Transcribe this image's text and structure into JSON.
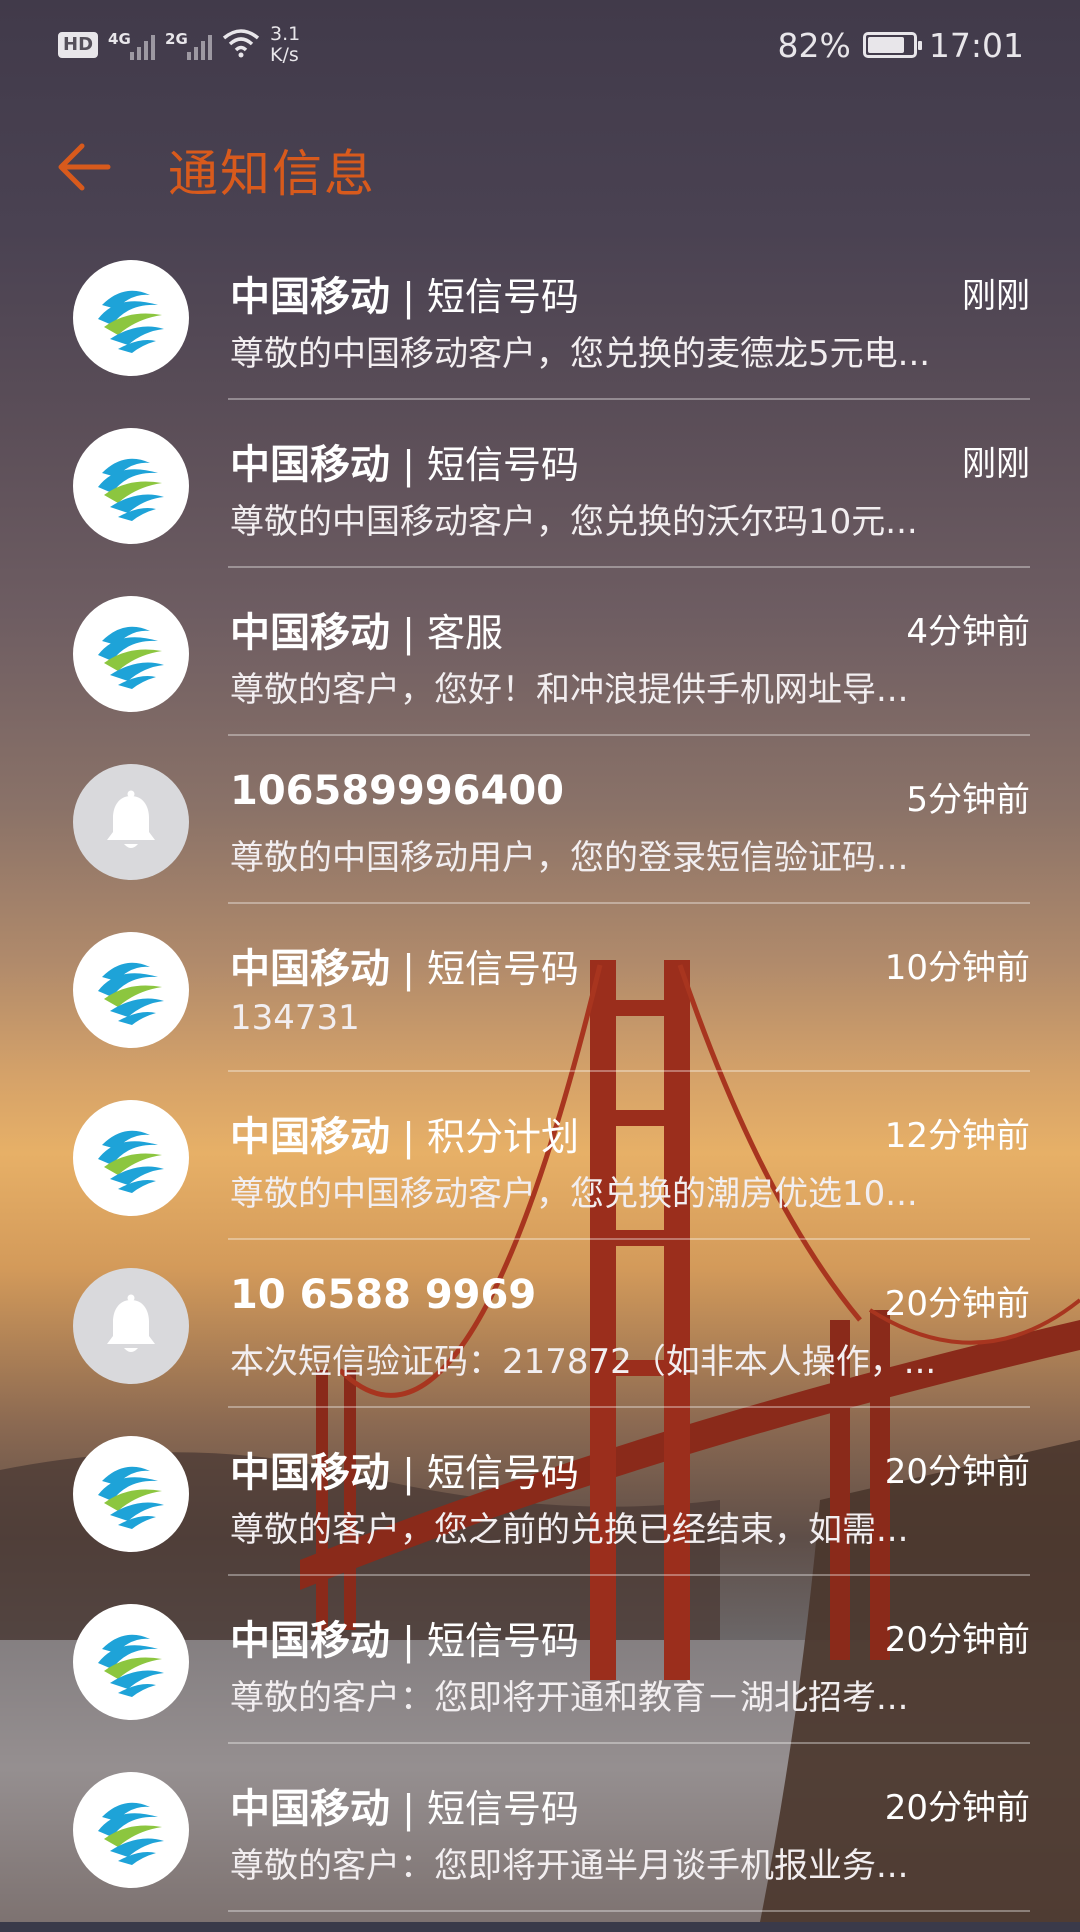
{
  "status_bar": {
    "hd": "HD",
    "net1": "4G",
    "net2": "2G",
    "speed_value": "3.1",
    "speed_unit": "K/s",
    "battery": "82%",
    "battery_level": 0.82,
    "time": "17:01"
  },
  "header": {
    "title": "通知信息"
  },
  "colors": {
    "accent": "#d85a1c",
    "cmcc_blue": "#1ea3d8",
    "cmcc_green": "#8cc63f"
  },
  "messages": [
    {
      "avatar": "cmcc-logo-icon",
      "sender": "中国移动",
      "sub": " | 短信号码",
      "time": "刚刚",
      "preview": "尊敬的中国移动客户，您兑换的麦德龙5元电..."
    },
    {
      "avatar": "cmcc-logo-icon",
      "sender": "中国移动",
      "sub": " | 短信号码",
      "time": "刚刚",
      "preview": "尊敬的中国移动客户，您兑换的沃尔玛10元..."
    },
    {
      "avatar": "cmcc-logo-icon",
      "sender": "中国移动",
      "sub": " | 客服",
      "time": "4分钟前",
      "preview": "尊敬的客户，您好！和冲浪提供手机网址导..."
    },
    {
      "avatar": "bell-icon",
      "sender": "106589996400",
      "sub": "",
      "time": "5分钟前",
      "preview": "尊敬的中国移动用户，您的登录短信验证码..."
    },
    {
      "avatar": "cmcc-logo-icon",
      "sender": "中国移动",
      "sub": " | 短信号码",
      "time": "10分钟前",
      "preview": "134731"
    },
    {
      "avatar": "cmcc-logo-icon",
      "sender": "中国移动",
      "sub": " | 积分计划",
      "time": "12分钟前",
      "preview": "尊敬的中国移动客户，您兑换的潮房优选10..."
    },
    {
      "avatar": "bell-icon",
      "sender": "10 6588 9969",
      "sub": "",
      "time": "20分钟前",
      "preview": "本次短信验证码：217872（如非本人操作，..."
    },
    {
      "avatar": "cmcc-logo-icon",
      "sender": "中国移动",
      "sub": " | 短信号码",
      "time": "20分钟前",
      "preview": "尊敬的客户，您之前的兑换已经结束，如需..."
    },
    {
      "avatar": "cmcc-logo-icon",
      "sender": "中国移动",
      "sub": " | 短信号码",
      "time": "20分钟前",
      "preview": "尊敬的客户：您即将开通和教育－湖北招考..."
    },
    {
      "avatar": "cmcc-logo-icon",
      "sender": "中国移动",
      "sub": " | 短信号码",
      "time": "20分钟前",
      "preview": "尊敬的客户：您即将开通半月谈手机报业务..."
    }
  ]
}
